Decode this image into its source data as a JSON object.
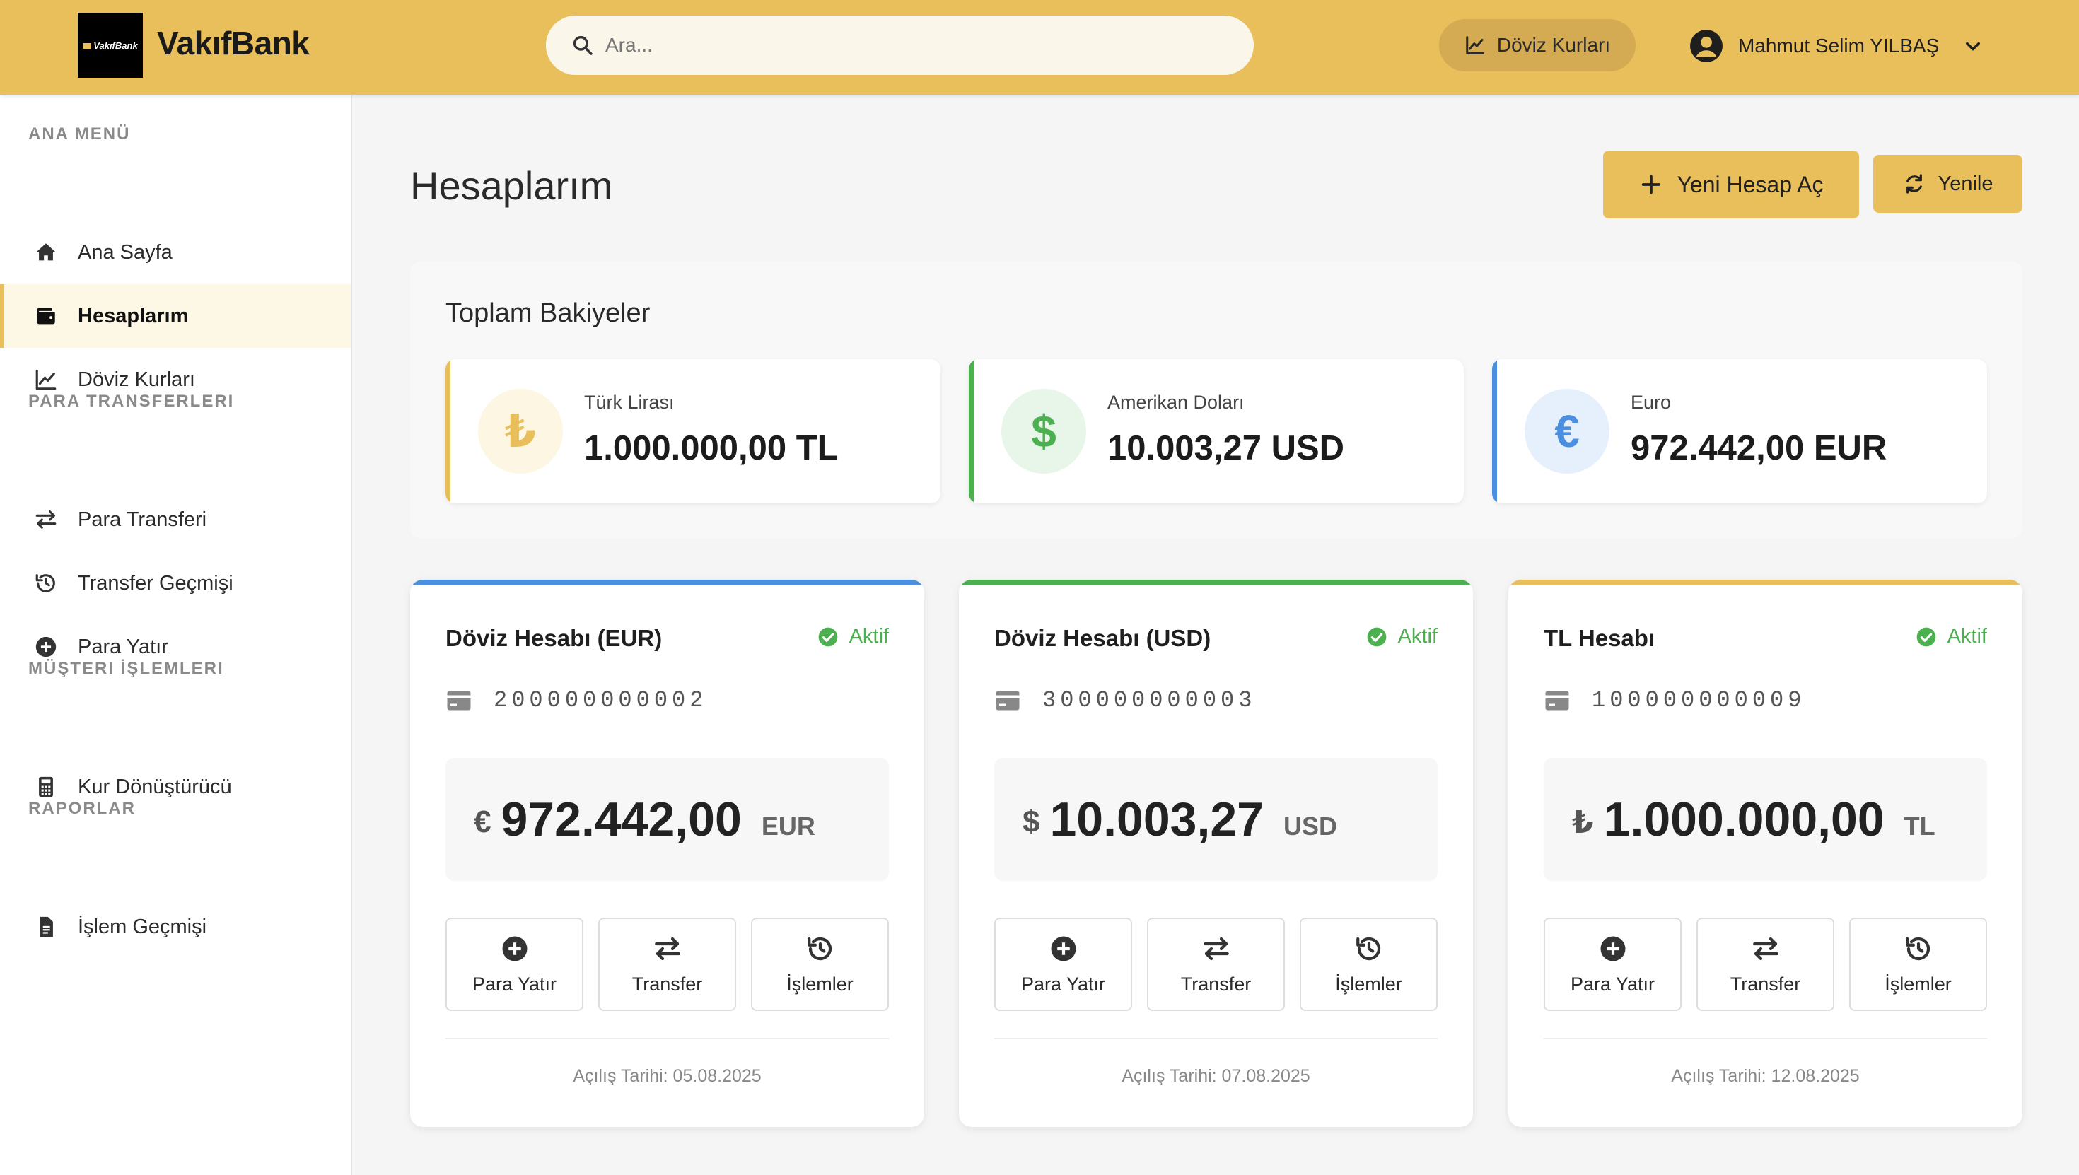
{
  "header": {
    "logo_text": "VakıfBank",
    "brand": "VakıfBank",
    "search_placeholder": "Ara...",
    "fx_button": "Döviz Kurları",
    "user_name": "Mahmut Selim YILBAŞ",
    "accent_color": "#e9bf5b"
  },
  "sidebar": {
    "sections": [
      {
        "title": "ANA MENÜ",
        "items": [
          {
            "label": "Ana Sayfa",
            "icon": "home-icon",
            "active": false
          },
          {
            "label": "Hesaplarım",
            "icon": "wallet-icon",
            "active": true
          },
          {
            "label": "Döviz Kurları",
            "icon": "chart-line-icon",
            "active": false
          }
        ]
      },
      {
        "title": "PARA TRANSFERLERI",
        "items": [
          {
            "label": "Para Transferi",
            "icon": "exchange-arrows-icon",
            "active": false
          },
          {
            "label": "Transfer Geçmişi",
            "icon": "history-icon",
            "active": false
          },
          {
            "label": "Para Yatır",
            "icon": "plus-circle-icon",
            "active": false
          }
        ]
      },
      {
        "title": "MÜŞTERI İŞLEMLERI",
        "items": [
          {
            "label": "Kur Dönüştürücü",
            "icon": "calculator-icon",
            "active": false
          }
        ]
      },
      {
        "title": "RAPORLAR",
        "items": [
          {
            "label": "İşlem Geçmişi",
            "icon": "document-icon",
            "active": false
          }
        ]
      }
    ]
  },
  "main": {
    "title": "Hesaplarım",
    "new_account_button": "Yeni Hesap Aç",
    "refresh_button": "Yenile",
    "totals": {
      "title": "Toplam Bakiyeler",
      "cards": [
        {
          "label": "Türk Lirası",
          "amount": "1.000.000,00 TL",
          "symbol": "₺",
          "color": "#e9bf5b",
          "bg": "#fdf6e2"
        },
        {
          "label": "Amerikan Doları",
          "amount": "10.003,27 USD",
          "symbol": "$",
          "color": "#4caf50",
          "bg": "#e8f5e9"
        },
        {
          "label": "Euro",
          "amount": "972.442,00 EUR",
          "symbol": "€",
          "color": "#4a8fe0",
          "bg": "#e6f0fc"
        }
      ]
    },
    "accounts": [
      {
        "title": "Döviz Hesabı (EUR)",
        "status": "Aktif",
        "number": "200000000002",
        "symbol": "€",
        "balance": "972.442,00",
        "currency": "EUR",
        "opened": "Açılış Tarihi: 05.08.2025",
        "color": "#4a8fe0"
      },
      {
        "title": "Döviz Hesabı (USD)",
        "status": "Aktif",
        "number": "300000000003",
        "symbol": "$",
        "balance": "10.003,27",
        "currency": "USD",
        "opened": "Açılış Tarihi: 07.08.2025",
        "color": "#4caf50"
      },
      {
        "title": "TL Hesabı",
        "status": "Aktif",
        "number": "100000000009",
        "symbol": "₺",
        "balance": "1.000.000,00",
        "currency": "TL",
        "opened": "Açılış Tarihi: 12.08.2025",
        "color": "#e9bf5b"
      }
    ],
    "account_actions": [
      "Para Yatır",
      "Transfer",
      "İşlemler"
    ]
  }
}
